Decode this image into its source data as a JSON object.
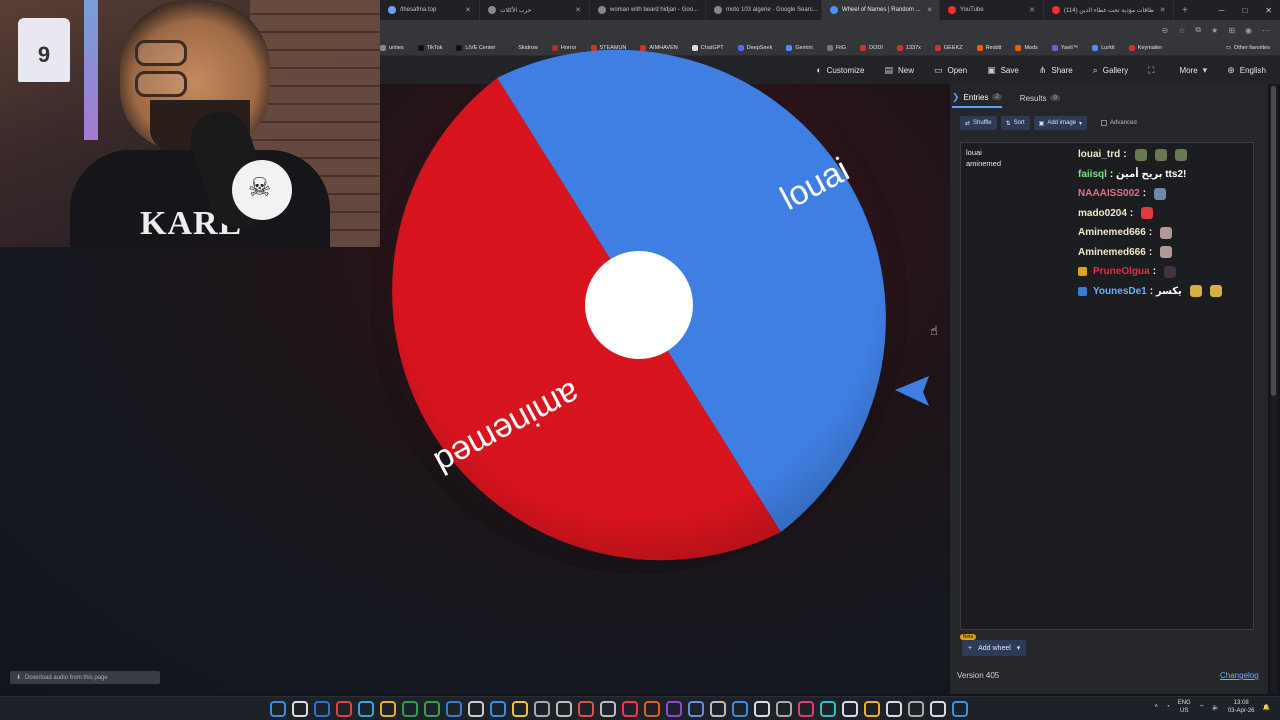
{
  "browser": {
    "tabs": [
      {
        "label": "/thesafma.top",
        "active": false,
        "color": "#6aa3ff"
      },
      {
        "label": "حرب الأكلات",
        "active": false,
        "color": "#888888"
      },
      {
        "label": "woman with beard hidjan - Goo...",
        "active": false,
        "color": "#888888"
      },
      {
        "label": "moto 103 algerie - Google Searc...",
        "active": false,
        "color": "#888888"
      },
      {
        "label": "Wheel of Names | Random ...",
        "active": true,
        "color": "#4a90ff"
      },
      {
        "label": "YouTube",
        "active": false,
        "color": "#ff2a2a"
      },
      {
        "label": "(114) طاقات مؤذية تحت غطاء الدين",
        "active": false,
        "color": "#ff2a2a"
      }
    ],
    "new_tab": "+",
    "bookmarks": [
      {
        "label": "unties",
        "color": "#888888"
      },
      {
        "label": "TikTok",
        "color": "#111111"
      },
      {
        "label": "LIVE Center",
        "color": "#111111"
      },
      {
        "label": "Skidrow",
        "color": "#333333"
      },
      {
        "label": "Horror",
        "color": "#b03030"
      },
      {
        "label": "STEAMUN",
        "color": "#d03030"
      },
      {
        "label": "AIMHAVEN",
        "color": "#d03030"
      },
      {
        "label": "ChatGPT",
        "color": "#dddddd"
      },
      {
        "label": "DeepSeek",
        "color": "#4d6bfe"
      },
      {
        "label": "Gemini",
        "color": "#4d8bfe"
      },
      {
        "label": "FitG",
        "color": "#777777"
      },
      {
        "label": "DODI",
        "color": "#d03030"
      },
      {
        "label": "1337x",
        "color": "#d03030"
      },
      {
        "label": "GEEKZ",
        "color": "#d03030"
      },
      {
        "label": "Reddit",
        "color": "#ff5700"
      },
      {
        "label": "Mods",
        "color": "#ff5700"
      },
      {
        "label": "Yaeli™",
        "color": "#8855cc"
      },
      {
        "label": "Lurkit",
        "color": "#4a90ff"
      },
      {
        "label": "Keymailer",
        "color": "#d03030"
      }
    ],
    "other_favorites": "Other favorites"
  },
  "site_toolbar": {
    "items": [
      {
        "label": "Customize",
        "icon": "palette-icon"
      },
      {
        "label": "New",
        "icon": "file-icon"
      },
      {
        "label": "Open",
        "icon": "folder-icon"
      },
      {
        "label": "Save",
        "icon": "save-icon"
      },
      {
        "label": "Share",
        "icon": "share-icon"
      },
      {
        "label": "Gallery",
        "icon": "search-icon"
      },
      {
        "label": "",
        "icon": "fullscreen-icon"
      },
      {
        "label": "More",
        "icon": "chevron-down-icon"
      },
      {
        "label": "English",
        "icon": "globe-icon"
      }
    ]
  },
  "webcam": {
    "jersey_number": "9",
    "shirt_text": "KARL"
  },
  "wheel": {
    "segments": [
      {
        "label": "louai",
        "color": "#3f7fe3"
      },
      {
        "label": "aminemed",
        "color": "#d8141e"
      }
    ],
    "pointer_color": "#3f7fe3"
  },
  "download_bar": "Download audio from this page",
  "panel": {
    "tabs": [
      {
        "label": "Entries",
        "count": "2",
        "active": true
      },
      {
        "label": "Results",
        "count": "0",
        "active": false
      }
    ],
    "controls": [
      {
        "label": "Shuffle",
        "icon": "shuffle-icon"
      },
      {
        "label": "Sort",
        "icon": "sort-icon"
      },
      {
        "label": "Add image",
        "icon": "image-icon"
      }
    ],
    "advanced_label": "Advanced",
    "entries": [
      "louai",
      "aminemed"
    ],
    "add_wheel_label": "Add wheel",
    "beta_label": "Beta",
    "version": "Version 405",
    "changelog": "Changelog"
  },
  "chat": [
    {
      "user": "louai_trd",
      "color": "#f0e6c8",
      "message": ":",
      "emotes": [
        "#6a7a50",
        "#6a7a50",
        "#6a7a50"
      ]
    },
    {
      "user": "faiisql",
      "color": "#7fe07f",
      "message": ": بريح أمين tts2!",
      "emotes": []
    },
    {
      "user": "NAAAISS002",
      "color": "#e06d8a",
      "message": ":",
      "emotes": [
        "#6a8aa8"
      ]
    },
    {
      "user": "mado0204",
      "color": "#f0e6c8",
      "message": ":",
      "emotes": [
        "#e03a3a"
      ]
    },
    {
      "user": "Aminemed666",
      "color": "#f0e6c8",
      "message": ":",
      "emotes": [
        "#b09a98"
      ]
    },
    {
      "user": "Aminemed666",
      "color": "#f0e6c8",
      "message": ":",
      "emotes": [
        "#b09a98"
      ]
    },
    {
      "user": "PruneOlgua",
      "color": "#e0304a",
      "message": ":",
      "emotes": [
        "#443344"
      ]
    },
    {
      "user": "YounesDe1",
      "color": "#6ab0ff",
      "message": ": يكسر",
      "emotes": [
        "#d8b040",
        "#d8b040"
      ]
    }
  ],
  "taskbar": {
    "language": "ENG",
    "region": "US",
    "time": "13:08",
    "date": "03-Apr-26"
  }
}
